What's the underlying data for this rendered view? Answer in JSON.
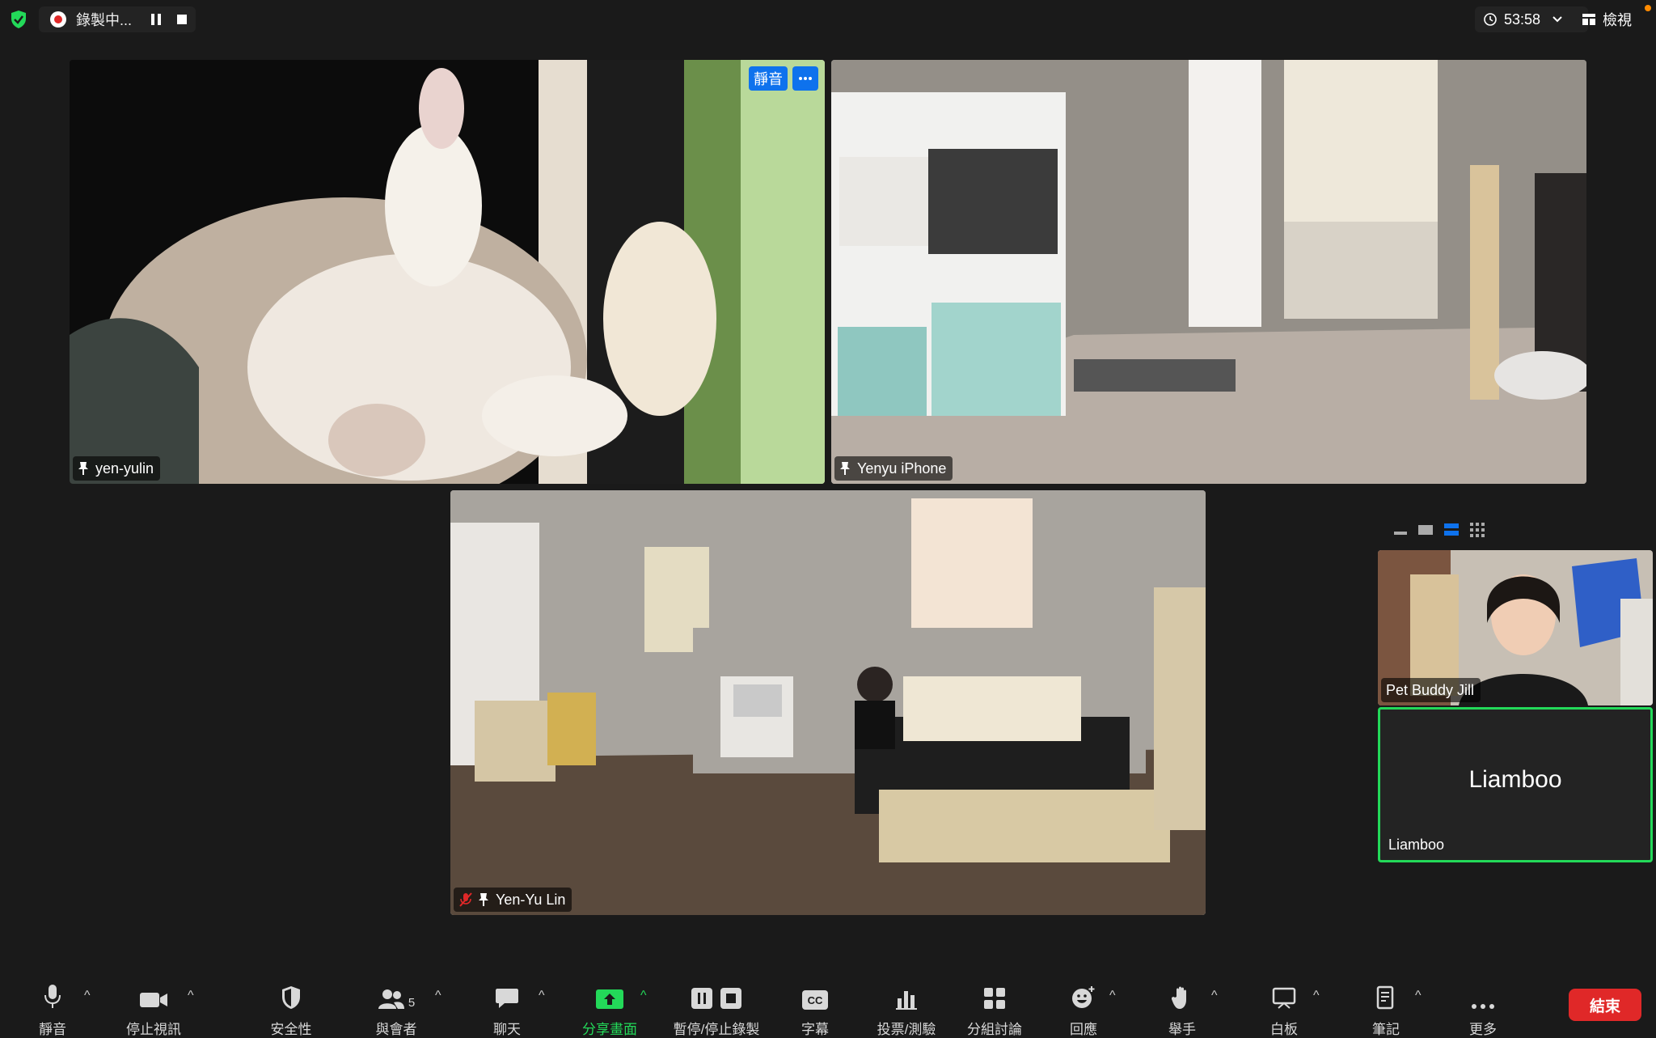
{
  "topbar": {
    "recording_label": "錄製中...",
    "timer": "53:58",
    "view_label": "檢視"
  },
  "tiles": {
    "top_left": {
      "name": "yen-yulin",
      "mute_label": "靜音"
    },
    "top_right": {
      "name": "Yenyu iPhone"
    },
    "bottom_center": {
      "name": "Yen-Yu Lin"
    }
  },
  "sidebar": {
    "participant_1": {
      "name": "Pet Buddy Jill"
    },
    "participant_2": {
      "name": "Liamboo",
      "display_name": "Liamboo"
    }
  },
  "toolbar": {
    "mute": "靜音",
    "stop_video": "停止視訊",
    "security": "安全性",
    "participants": "與會者",
    "participants_count": "5",
    "chat": "聊天",
    "share_screen": "分享畫面",
    "pause_stop_recording": "暫停/停止錄製",
    "captions": "字幕",
    "captions_icon_text": "CC",
    "polls": "投票/測驗",
    "breakout_rooms": "分組討論",
    "reactions": "回應",
    "raise_hand": "舉手",
    "whiteboard": "白板",
    "notes": "筆記",
    "more": "更多",
    "end": "結束"
  },
  "colors": {
    "accent_blue": "#0e72ed",
    "share_green": "#23d959",
    "end_red": "#e02828",
    "notification_orange": "#ff8a00"
  }
}
